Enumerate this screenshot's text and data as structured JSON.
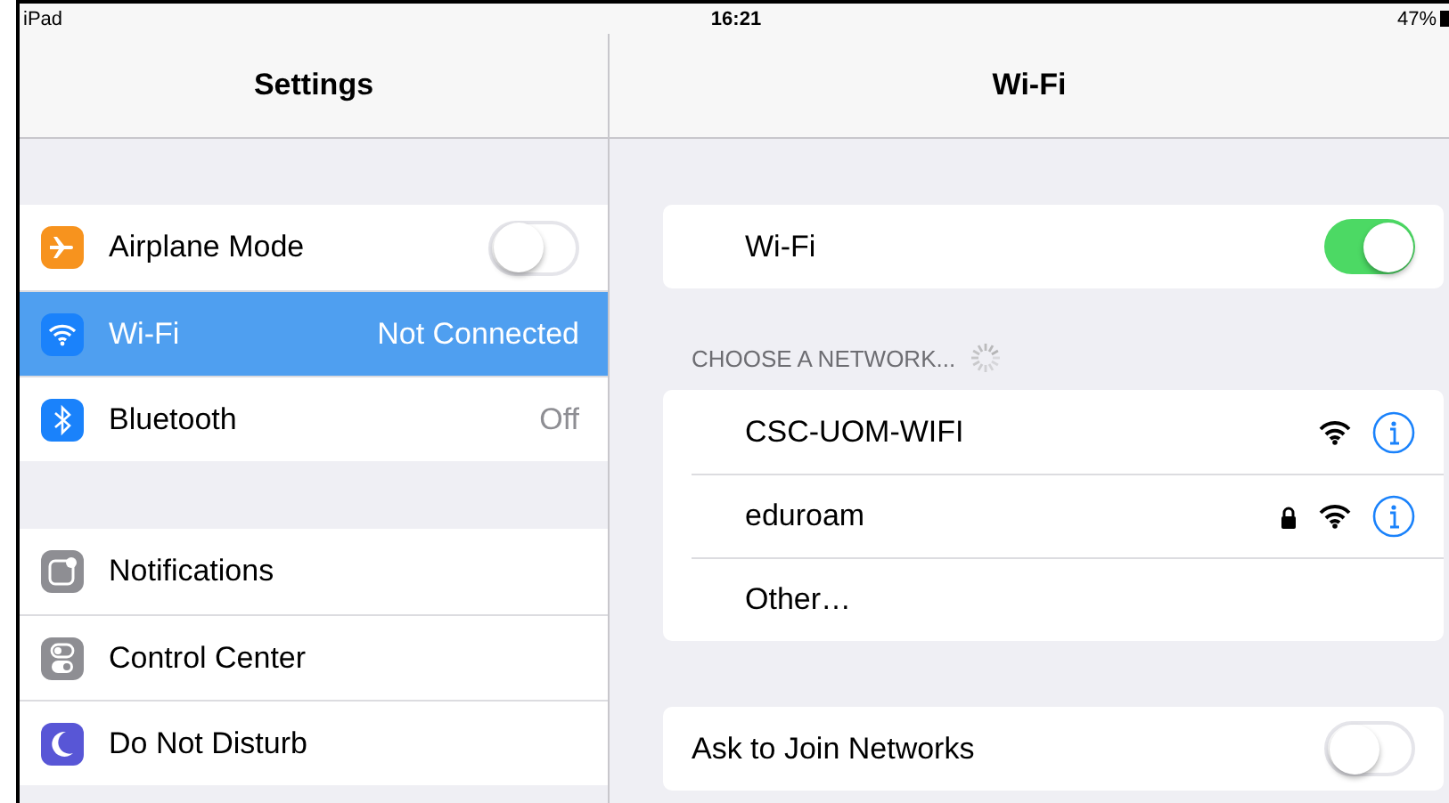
{
  "status_bar": {
    "device": "iPad",
    "time": "16:21",
    "battery": "47%"
  },
  "sidebar": {
    "title": "Settings",
    "groups": [
      {
        "items": [
          {
            "label": "Airplane Mode",
            "kind": "toggle",
            "on": false,
            "selected": false,
            "color": "#f7931e"
          },
          {
            "label": "Wi-Fi",
            "kind": "value",
            "value": "Not Connected",
            "selected": true,
            "color": "#1a82fb"
          },
          {
            "label": "Bluetooth",
            "kind": "value",
            "value": "Off",
            "selected": false,
            "color": "#1a82fb"
          }
        ]
      },
      {
        "items": [
          {
            "label": "Notifications",
            "kind": "link",
            "selected": false,
            "color": "#8e8e93"
          },
          {
            "label": "Control Center",
            "kind": "link",
            "selected": false,
            "color": "#8e8e93"
          },
          {
            "label": "Do Not Disturb",
            "kind": "link",
            "selected": false,
            "color": "#5856d6"
          }
        ]
      }
    ]
  },
  "detail": {
    "title": "Wi-Fi",
    "wifi": {
      "label": "Wi-Fi",
      "on": true
    },
    "section_header": "CHOOSE A NETWORK...",
    "networks": [
      {
        "name": "CSC-UOM-WIFI",
        "kind": "network",
        "locked": false
      },
      {
        "name": "eduroam",
        "kind": "network",
        "locked": true
      },
      {
        "name": "Other…",
        "kind": "other"
      }
    ],
    "ask_to_join": {
      "label": "Ask to Join Networks",
      "on": false
    }
  }
}
